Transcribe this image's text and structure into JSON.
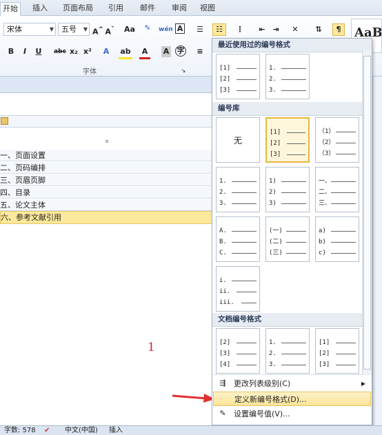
{
  "ribbon_tabs": [
    "开始",
    "插入",
    "页面布局",
    "引用",
    "邮件",
    "审阅",
    "视图"
  ],
  "font": {
    "name": "宋体",
    "size": "五号",
    "group_label": "字体"
  },
  "style_preview": "AaBb",
  "nav_items": [
    "一、页面设置",
    "二、页码编排",
    "三、页眉页脚",
    "四、目录",
    "五、论文主体",
    "六、参考文献引用"
  ],
  "dropdown": {
    "recent_header": "最近使用过的编号格式",
    "library_header": "编号库",
    "document_header": "文档编号格式",
    "none_label": "无",
    "recent": [
      [
        "[1]",
        "[2]",
        "[3]"
      ],
      [
        "1.",
        "2.",
        "3."
      ]
    ],
    "library": [
      [
        [
          "[1]",
          "[2]",
          "[3]"
        ],
        [
          "（1）",
          "（2）",
          "（3）"
        ]
      ],
      [
        [
          "1.",
          "2.",
          "3."
        ],
        [
          "1)",
          "2)",
          "3)"
        ],
        [
          "一、",
          "二、",
          "三、"
        ]
      ],
      [
        [
          "A.",
          "B.",
          "C."
        ],
        [
          "(一)",
          "(二)",
          "(三)"
        ],
        [
          "a)",
          "b)",
          "c)"
        ]
      ],
      [
        [
          "i.",
          "ii.",
          "iii."
        ]
      ]
    ],
    "document": [
      [
        "[2]",
        "[3]",
        "[4]"
      ],
      [
        "1.",
        "2.",
        "3."
      ],
      [
        "[1]",
        "[2]",
        "[3]"
      ]
    ],
    "menu": {
      "change_level": "更改列表级别(C)",
      "define_new": "定义新编号格式(D)...",
      "set_value": "设置编号值(V)..."
    }
  },
  "annotation": "1",
  "status": {
    "words": "字数: 578",
    "lang": "中文(中国)",
    "mode": "插入"
  },
  "colors": {
    "highlight": "#fde99b",
    "arrow": "#e03030",
    "annotation": "#d22"
  }
}
